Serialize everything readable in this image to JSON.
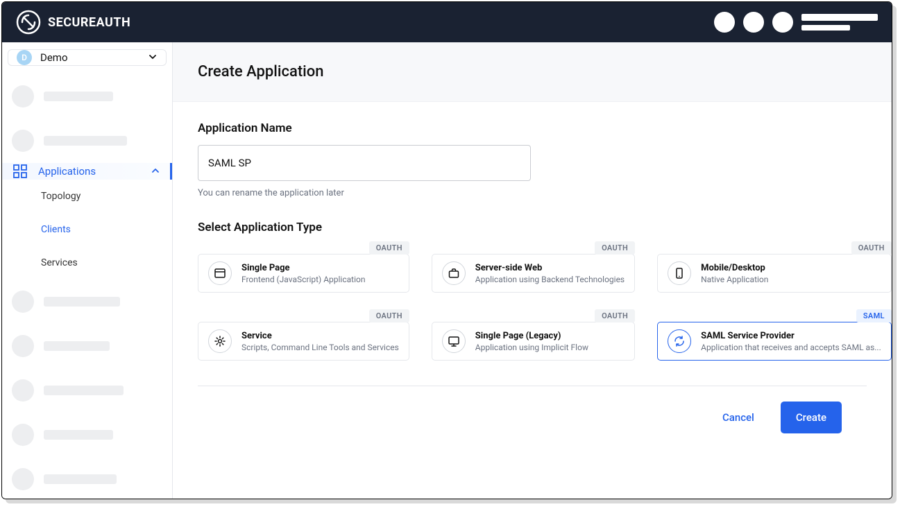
{
  "brand": {
    "name": "SECUREAUTH"
  },
  "workspace": {
    "badge": "D",
    "name": "Demo"
  },
  "sidebar": {
    "applications_label": "Applications",
    "subnav": {
      "topology": "Topology",
      "clients": "Clients",
      "services": "Services"
    }
  },
  "page": {
    "title": "Create Application",
    "appname_label": "Application Name",
    "appname_value": "SAML SP",
    "appname_hint": "You can rename the application later",
    "type_label": "Select Application Type"
  },
  "types": [
    {
      "badge": "OAUTH",
      "title": "Single Page",
      "desc": "Frontend (JavaScript) Application",
      "icon": "window",
      "selected": false
    },
    {
      "badge": "OAUTH",
      "title": "Server-side Web",
      "desc": "Application using Backend Technologies",
      "icon": "briefcase",
      "selected": false
    },
    {
      "badge": "OAUTH",
      "title": "Mobile/Desktop",
      "desc": "Native Application",
      "icon": "mobile",
      "selected": false
    },
    {
      "badge": "OAUTH",
      "title": "Service",
      "desc": "Scripts, Command Line Tools and Services",
      "icon": "gear",
      "selected": false
    },
    {
      "badge": "OAUTH",
      "title": "Single Page (Legacy)",
      "desc": "Application using Implicit Flow",
      "icon": "monitor",
      "selected": false
    },
    {
      "badge": "SAML",
      "title": "SAML Service Provider",
      "desc": "Application that receives and accepts SAML as...",
      "icon": "exchange",
      "selected": true
    }
  ],
  "buttons": {
    "cancel": "Cancel",
    "create": "Create"
  }
}
